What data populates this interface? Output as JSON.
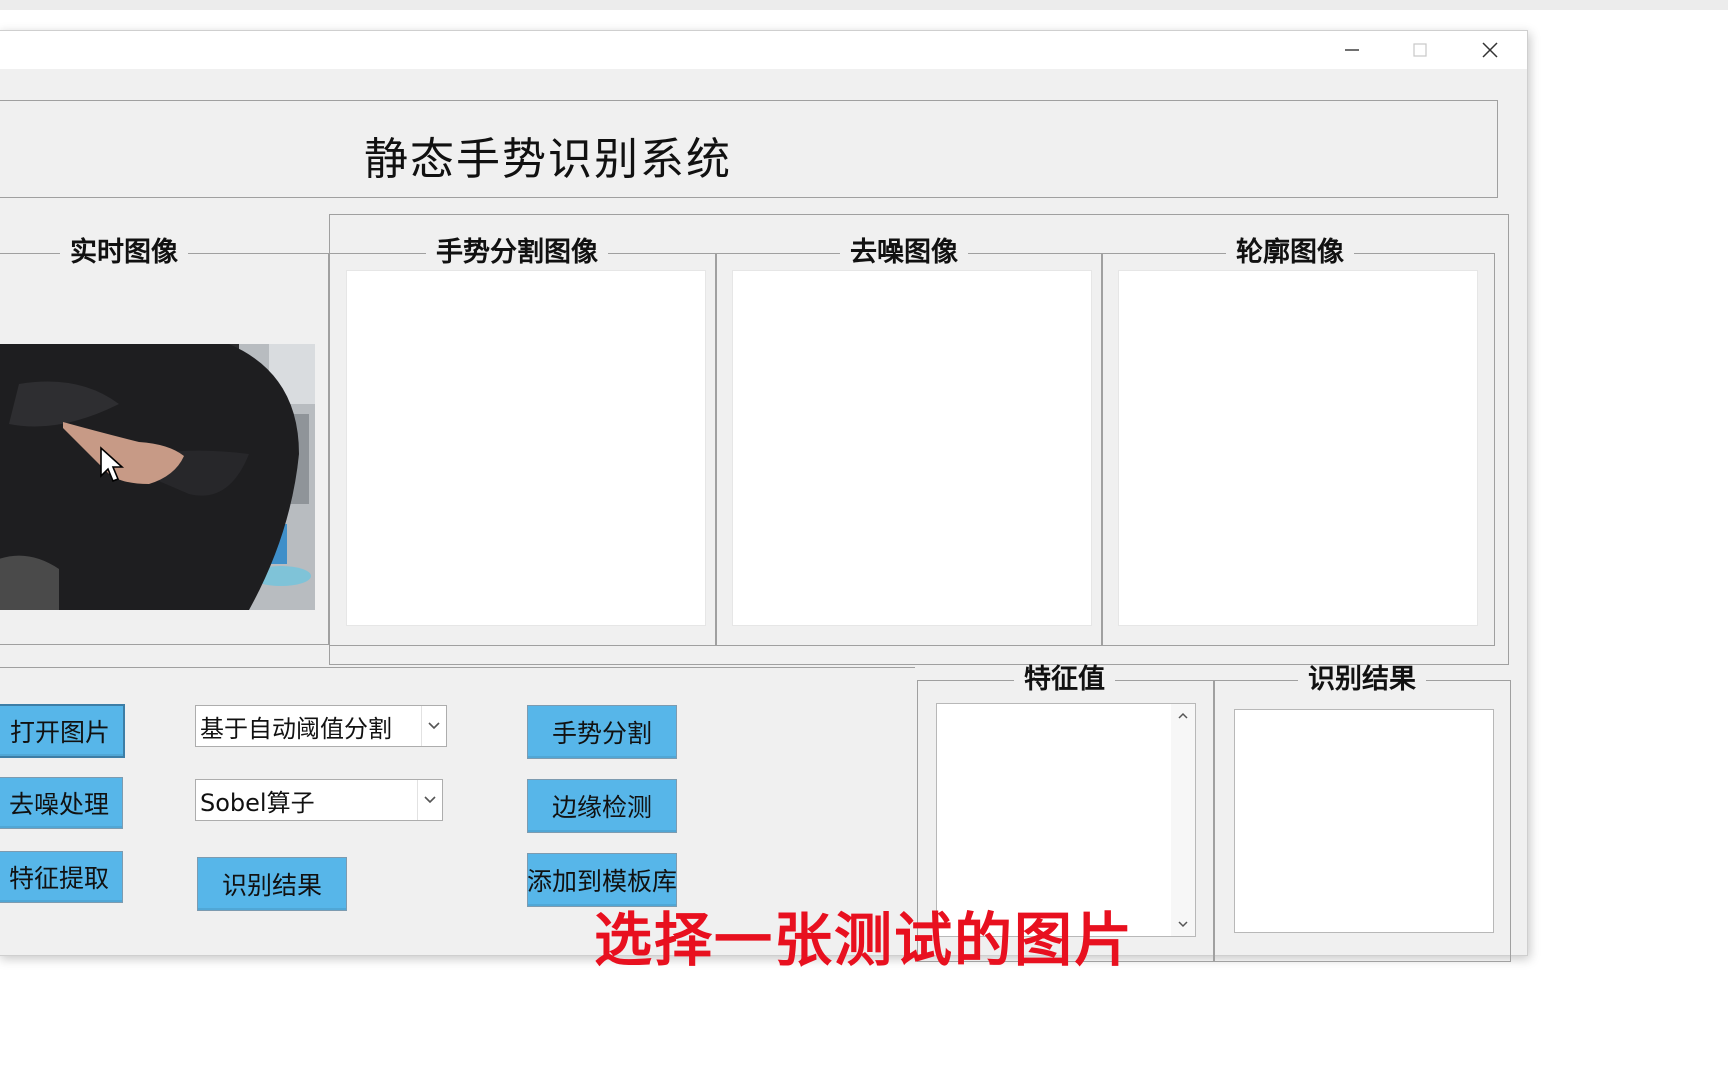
{
  "window": {
    "title": "静态手势识别系统",
    "minimize_icon": "minimize-icon",
    "maximize_icon": "maximize-icon",
    "close_icon": "close-icon"
  },
  "panels": {
    "realtime": "实时图像",
    "segmentation": "手势分割图像",
    "denoise": "去噪图像",
    "contour": "轮廓图像",
    "features": "特征值",
    "result": "识别结果"
  },
  "buttons": {
    "open_image": "打开图片",
    "denoise": "去噪处理",
    "feature_extract": "特征提取",
    "recognize": "识别结果",
    "segment": "手势分割",
    "edge_detect": "边缘检测",
    "add_template": "添加到模板库"
  },
  "selects": {
    "segmentation_method": "基于自动阈值分割",
    "edge_operator": "Sobel算子"
  },
  "caption": "选择一张测试的图片",
  "colors": {
    "button_bg": "#57b6e9",
    "caption": "#e8101f",
    "window_bg": "#f0f0f0"
  },
  "icons": [
    "minimize-icon",
    "maximize-icon",
    "close-icon",
    "chevron-down-icon",
    "scroll-up-icon",
    "scroll-down-icon",
    "mouse-cursor-icon"
  ]
}
